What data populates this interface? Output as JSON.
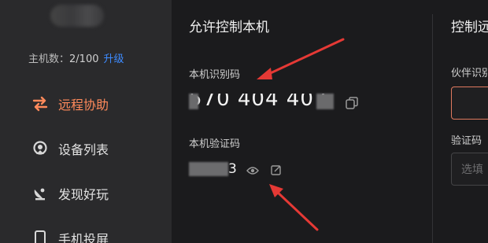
{
  "sidebar": {
    "host_count_label": "主机数：",
    "host_count_value": "2/100",
    "upgrade_label": "升级",
    "items": [
      {
        "label": "远程协助",
        "icon": "swap-arrows-icon",
        "active": true
      },
      {
        "label": "设备列表",
        "icon": "device-icon"
      },
      {
        "label": "发现好玩",
        "icon": "satellite-dish-icon"
      },
      {
        "label": "手机投屏",
        "icon": "phone-icon"
      }
    ]
  },
  "allow": {
    "title": "允许控制本机",
    "id_label": "本机识别码",
    "id_value": "570 404 407",
    "code_label": "本机验证码",
    "code_visible_end": "3"
  },
  "control": {
    "title": "控制远",
    "partner_label": "伙伴识别",
    "verify_label": "验证码",
    "verify_placeholder": "选填"
  },
  "colors": {
    "accent": "#ff8a5b",
    "link": "#3d8bff",
    "annotation_arrow": "#e53935"
  }
}
